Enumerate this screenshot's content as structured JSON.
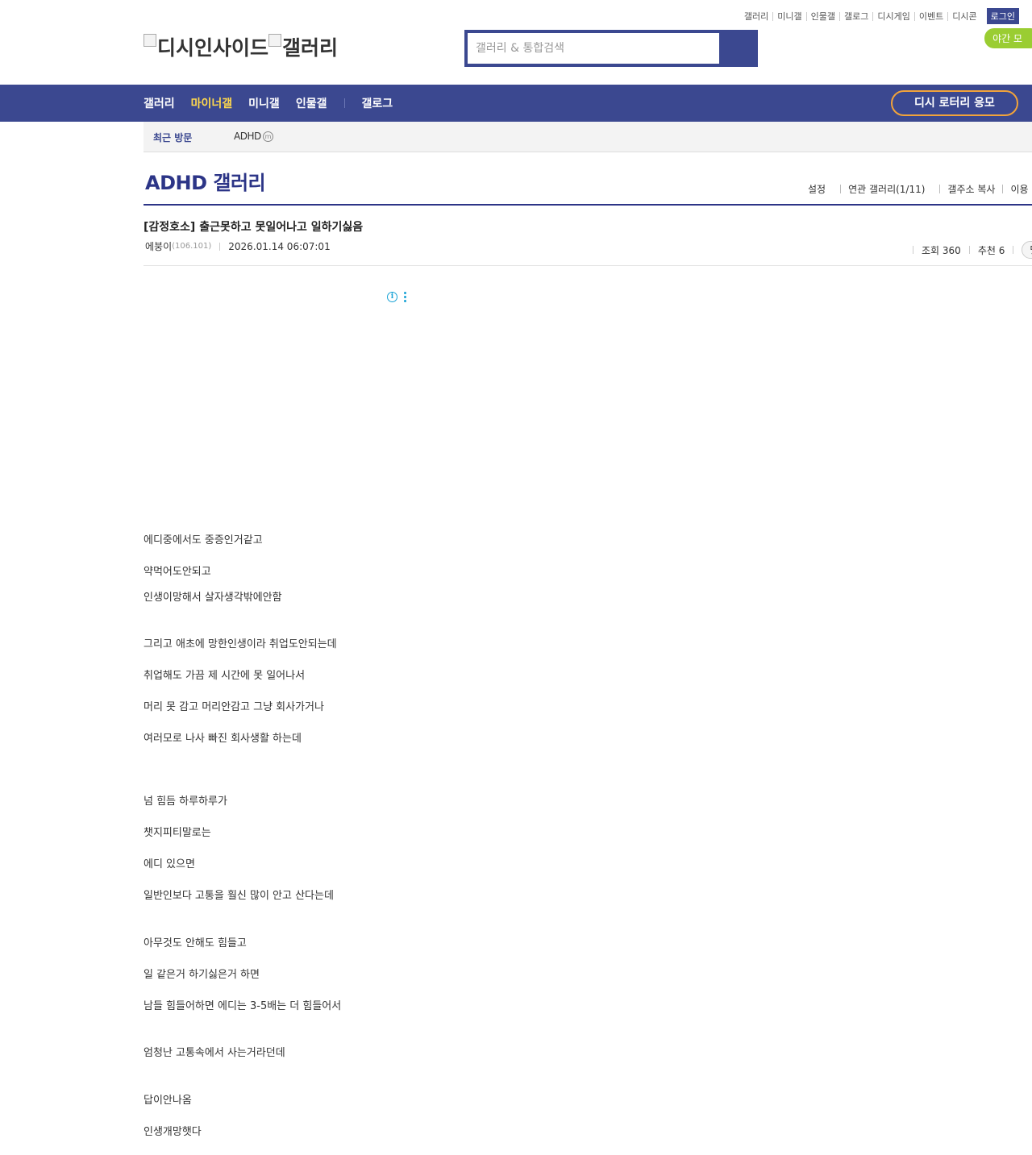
{
  "util_nav": {
    "links": [
      "갤러리",
      "미니갤",
      "인물갤",
      "갤로그",
      "디시게임",
      "이벤트",
      "디시콘"
    ],
    "login": "로그인",
    "night_mode": "야간 모"
  },
  "logo": {
    "brand_alt": "디시인사이드",
    "gallery_alt": "갤러리"
  },
  "search": {
    "placeholder": "갤러리 & 통합검색"
  },
  "gnb": {
    "items": [
      "갤러리",
      "마이너갤",
      "미니갤",
      "인물갤",
      "갤로그"
    ],
    "active_index": 1,
    "lotto_button": "디시 로터리 응모"
  },
  "recent": {
    "label": "최근 방문",
    "items": [
      "ADHD"
    ],
    "minor_badge": "m"
  },
  "gallery": {
    "title": "ADHD 갤러리",
    "tools": [
      "설정",
      "연관 갤러리(1/11)",
      "갤주소 복사",
      "이용"
    ]
  },
  "post": {
    "title": "[감정호소] 출근못하고 못일어나고 일하기싫음",
    "author": "에붕이",
    "ip": "(106.101)",
    "date": "2026.01.14 06:07:01",
    "views_label": "조회 360",
    "recommend_label": "추천 6",
    "more_button": "댓",
    "lines": [
      "에디중에서도 중증인거같고",
      "약먹어도안되고",
      "인생이망해서 살자생각밖에안함",
      "그리고 애초에 망한인생이라 취업도안되는데",
      "취업해도 가끔 제 시간에 못 일어나서",
      "머리 못 감고 머리안감고 그냥 회사가거나",
      "여러모로 나사 빠진 회사생활 하는데",
      "넘 힘듬 하루하루가",
      "챗지피티말로는",
      "에디 있으면",
      "일반인보다 고통을 훨신 많이 안고 산다는데",
      "아무것도 안해도 힘들고",
      "일 같은거 하기싫은거 하면",
      "남들 힘들어하면 에디는 3-5배는 더 힘들어서",
      "엄청난 고통속에서 사는거라던데",
      "답이안나옴",
      "인생개망햇다"
    ]
  }
}
